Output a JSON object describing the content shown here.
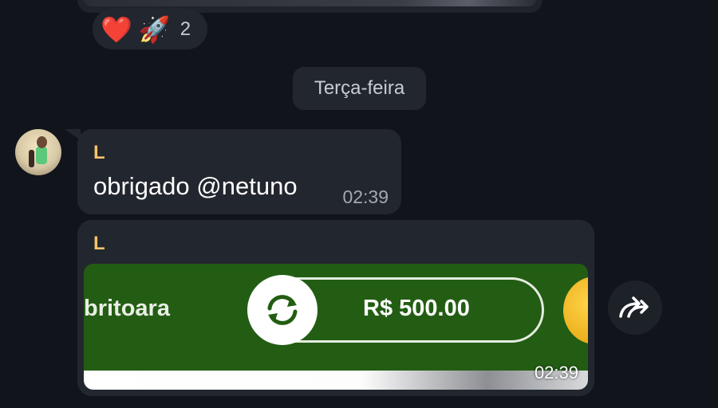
{
  "previous": {
    "reactions": [
      {
        "icon": "heart",
        "emoji": "❤️"
      },
      {
        "icon": "rocket",
        "emoji": "🚀"
      }
    ],
    "count": "2"
  },
  "date_separator": "Terça-feira",
  "messages": [
    {
      "sender": "L",
      "text": "obrigado @netuno",
      "time": "02:39"
    },
    {
      "sender": "L",
      "media": {
        "game_label": "britoara",
        "amount": "R$ 500.00"
      },
      "time": "02:39"
    }
  ],
  "colors": {
    "background": "#12141b",
    "bubble": "#22262e",
    "sender_name": "#f5c46b",
    "media_green": "#235d13",
    "timestamp": "#a3a8b1"
  },
  "icons": {
    "avatar": "avatar-photo",
    "refresh": "refresh-icon",
    "share": "forward-share-icon"
  }
}
